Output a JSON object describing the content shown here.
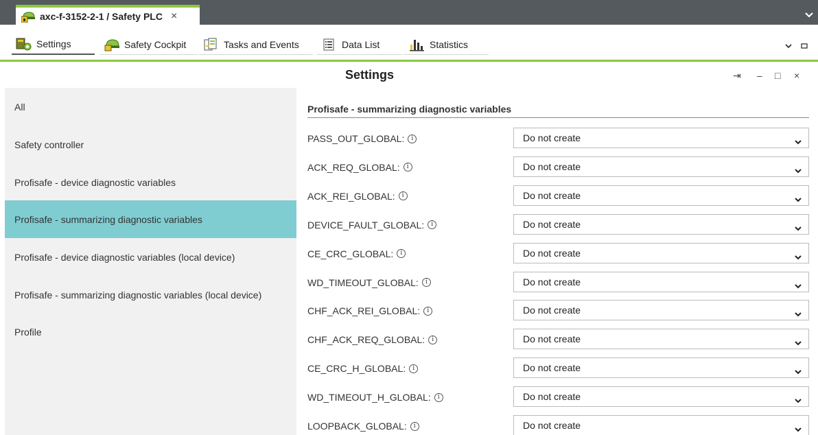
{
  "window": {
    "tab_title": "axc-f-3152-2-1 / Safety PLC",
    "tab_close": "×"
  },
  "toolbar": {
    "items": [
      {
        "label": "Settings",
        "icon": "settings-icon"
      },
      {
        "label": "Safety Cockpit",
        "icon": "safety-cockpit-icon"
      },
      {
        "label": "Tasks and Events",
        "icon": "tasks-icon"
      },
      {
        "label": "Data List",
        "icon": "data-list-icon"
      },
      {
        "label": "Statistics",
        "icon": "statistics-icon"
      }
    ]
  },
  "panel": {
    "title": "Settings",
    "pin": "⇥",
    "minimize": "–",
    "maximize": "□",
    "close": "×"
  },
  "nav": {
    "items": [
      "All",
      "Safety controller",
      "Profisafe - device diagnostic variables",
      "Profisafe - summarizing diagnostic variables",
      "Profisafe - device diagnostic variables (local device)",
      "Profisafe - summarizing diagnostic variables (local device)",
      "Profile"
    ],
    "selected_index": 3
  },
  "section": {
    "title": "Profisafe - summarizing diagnostic variables",
    "info_glyph": "i",
    "rows": [
      {
        "label": "PASS_OUT_GLOBAL:",
        "value": "Do not create"
      },
      {
        "label": "ACK_REQ_GLOBAL:",
        "value": "Do not create"
      },
      {
        "label": "ACK_REI_GLOBAL:",
        "value": "Do not create"
      },
      {
        "label": "DEVICE_FAULT_GLOBAL:",
        "value": "Do not create"
      },
      {
        "label": "CE_CRC_GLOBAL:",
        "value": "Do not create"
      },
      {
        "label": "WD_TIMEOUT_GLOBAL:",
        "value": "Do not create"
      },
      {
        "label": "CHF_ACK_REI_GLOBAL:",
        "value": "Do not create"
      },
      {
        "label": "CHF_ACK_REQ_GLOBAL:",
        "value": "Do not create"
      },
      {
        "label": "CE_CRC_H_GLOBAL:",
        "value": "Do not create"
      },
      {
        "label": "WD_TIMEOUT_H_GLOBAL:",
        "value": "Do not create"
      },
      {
        "label": "LOOPBACK_GLOBAL:",
        "value": "Do not create"
      }
    ]
  },
  "colors": {
    "accent_green": "#8cc63f",
    "selected_nav": "#7fcdd1",
    "tabstrip": "#555a5e"
  }
}
